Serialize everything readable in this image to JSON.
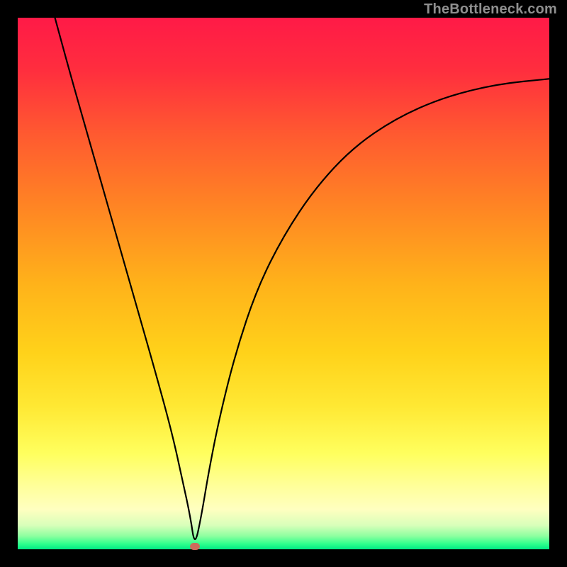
{
  "watermark": "TheBottleneck.com",
  "colors": {
    "frame": "#000000",
    "curve": "#000000",
    "marker": "#ce6a5b",
    "gradient_stops": [
      {
        "pos": 0.0,
        "color": "#ff1a47"
      },
      {
        "pos": 0.1,
        "color": "#ff2e3e"
      },
      {
        "pos": 0.22,
        "color": "#ff5a30"
      },
      {
        "pos": 0.35,
        "color": "#ff8324"
      },
      {
        "pos": 0.5,
        "color": "#ffb21a"
      },
      {
        "pos": 0.63,
        "color": "#ffd21a"
      },
      {
        "pos": 0.73,
        "color": "#ffe833"
      },
      {
        "pos": 0.82,
        "color": "#ffff5e"
      },
      {
        "pos": 0.88,
        "color": "#ffff99"
      },
      {
        "pos": 0.925,
        "color": "#ffffc0"
      },
      {
        "pos": 0.955,
        "color": "#d8ffba"
      },
      {
        "pos": 0.975,
        "color": "#8effa0"
      },
      {
        "pos": 0.99,
        "color": "#2eff8c"
      },
      {
        "pos": 1.0,
        "color": "#00e885"
      }
    ]
  },
  "chart_data": {
    "type": "line",
    "title": "",
    "xlabel": "",
    "ylabel": "",
    "xlim": [
      0,
      100
    ],
    "ylim": [
      0,
      100
    ],
    "grid": false,
    "legend": false,
    "series": [
      {
        "name": "curve",
        "x": [
          7,
          10,
          14,
          18,
          22,
          26,
          29,
          31,
          32.5,
          33.3,
          34.5,
          36,
          38,
          41,
          45,
          50,
          56,
          63,
          71,
          80,
          90,
          100
        ],
        "y": [
          100,
          89,
          75,
          61,
          47,
          33,
          22,
          13,
          6,
          0.5,
          6,
          15,
          25,
          37,
          49,
          59,
          68,
          75.5,
          81,
          85,
          87.5,
          88.5
        ]
      }
    ],
    "marker": {
      "x": 33.3,
      "y": 0.5
    },
    "annotations": [
      {
        "text": "TheBottleneck.com",
        "position": "top-right"
      }
    ]
  }
}
